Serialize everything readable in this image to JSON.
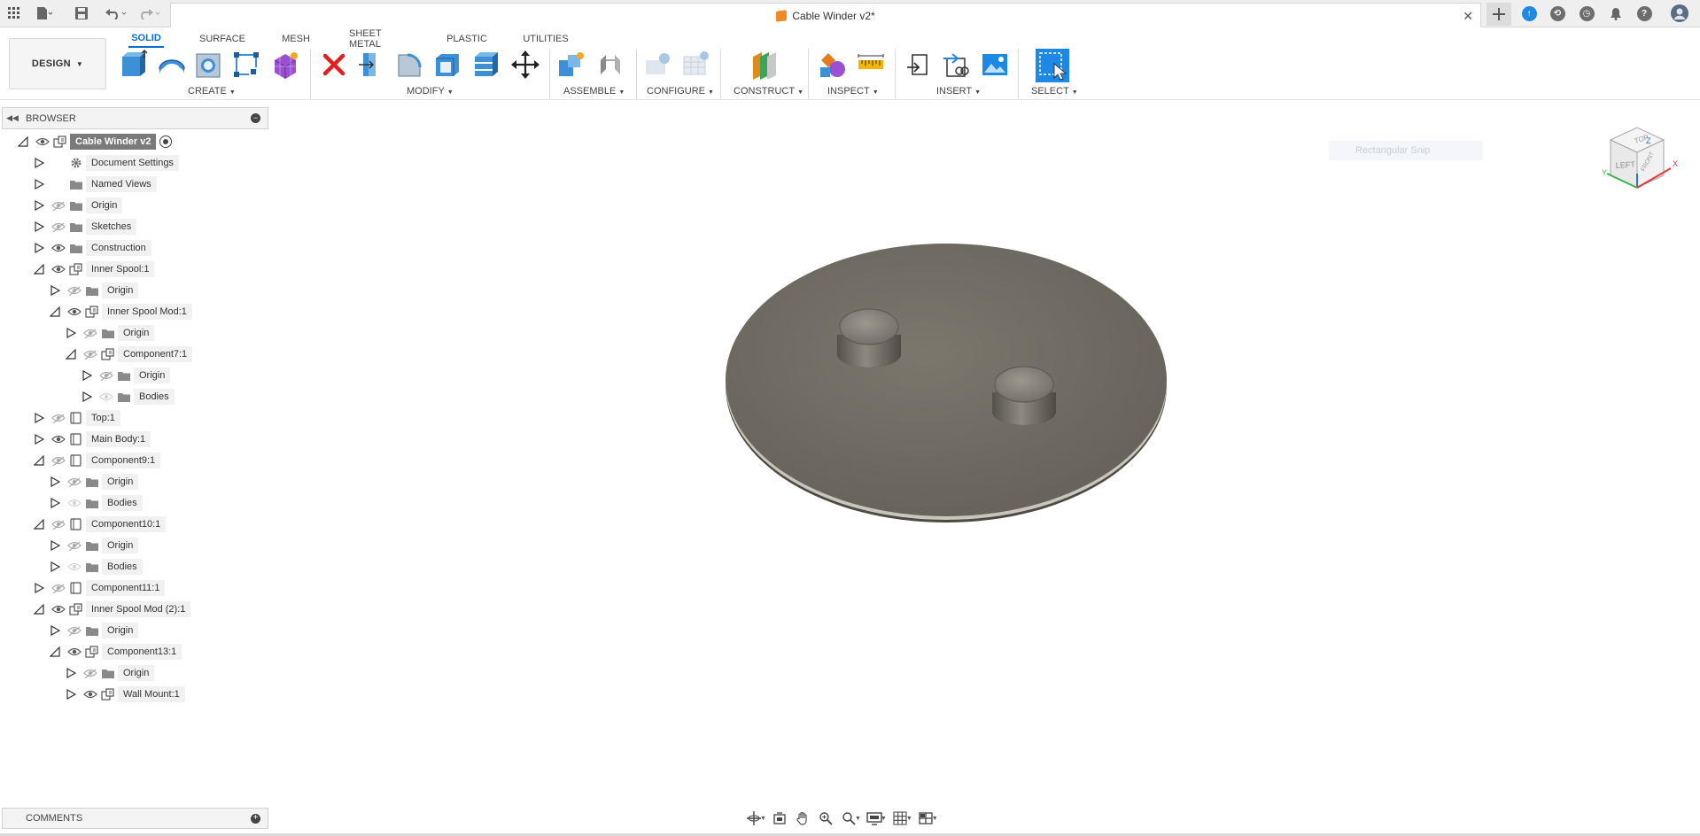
{
  "window": {
    "title": "Cable Winder v2*"
  },
  "toolbar": {
    "design_label": "DESIGN",
    "tabs": [
      {
        "label": "SOLID"
      },
      {
        "label": "SURFACE"
      },
      {
        "label": "MESH"
      },
      {
        "label": "SHEET METAL"
      },
      {
        "label": "PLASTIC"
      },
      {
        "label": "UTILITIES"
      }
    ],
    "groups": [
      {
        "label": "CREATE"
      },
      {
        "label": "MODIFY"
      },
      {
        "label": "ASSEMBLE"
      },
      {
        "label": "CONFIGURE"
      },
      {
        "label": "CONSTRUCT"
      },
      {
        "label": "INSPECT"
      },
      {
        "label": "INSERT"
      },
      {
        "label": "SELECT"
      }
    ]
  },
  "browser": {
    "header": "BROWSER",
    "items": [
      {
        "label": "Cable Winder v2"
      },
      {
        "label": "Document Settings"
      },
      {
        "label": "Named Views"
      },
      {
        "label": "Origin"
      },
      {
        "label": "Sketches"
      },
      {
        "label": "Construction"
      },
      {
        "label": "Inner Spool:1"
      },
      {
        "label": "Origin"
      },
      {
        "label": "Inner Spool Mod:1"
      },
      {
        "label": "Origin"
      },
      {
        "label": "Component7:1"
      },
      {
        "label": "Origin"
      },
      {
        "label": "Bodies"
      },
      {
        "label": "Top:1"
      },
      {
        "label": "Main Body:1"
      },
      {
        "label": "Component9:1"
      },
      {
        "label": "Origin"
      },
      {
        "label": "Bodies"
      },
      {
        "label": "Component10:1"
      },
      {
        "label": "Origin"
      },
      {
        "label": "Bodies"
      },
      {
        "label": "Component11:1"
      },
      {
        "label": "Inner Spool Mod (2):1"
      },
      {
        "label": "Origin"
      },
      {
        "label": "Component13:1"
      },
      {
        "label": "Origin"
      },
      {
        "label": "Wall Mount:1"
      }
    ]
  },
  "viewport": {
    "snip_hint": "Rectangular Snip",
    "viewcube": {
      "face_left": "LEFT",
      "face_top": "TOP",
      "face_front": "FRONT",
      "axis_x": "X",
      "axis_y": "Y",
      "axis_z": "Z"
    }
  },
  "comments": {
    "label": "COMMENTS"
  },
  "colors": {
    "accent": "#0a6ed1",
    "model": "#6f6b62",
    "toolbar_bg": "#ffffff",
    "titlebar_bg": "#efefef"
  }
}
